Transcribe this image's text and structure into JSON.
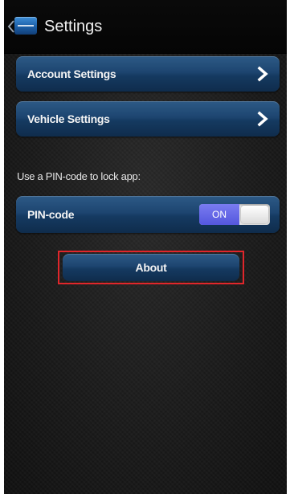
{
  "header": {
    "title": "Settings"
  },
  "menu": {
    "account_settings": "Account Settings",
    "vehicle_settings": "Vehicle Settings"
  },
  "pin": {
    "section_label": "Use a PIN-code to lock app:",
    "row_label": "PIN-code",
    "toggle_state": "ON",
    "enabled": true
  },
  "about": {
    "label": "About"
  },
  "colors": {
    "button_blue": "#1d4570",
    "toggle_on": "#5457de",
    "highlight_red": "#e0262b"
  },
  "icons": {
    "back": "chevron-left-icon",
    "row_arrow": "chevron-right-icon",
    "logo": "app-logo"
  }
}
